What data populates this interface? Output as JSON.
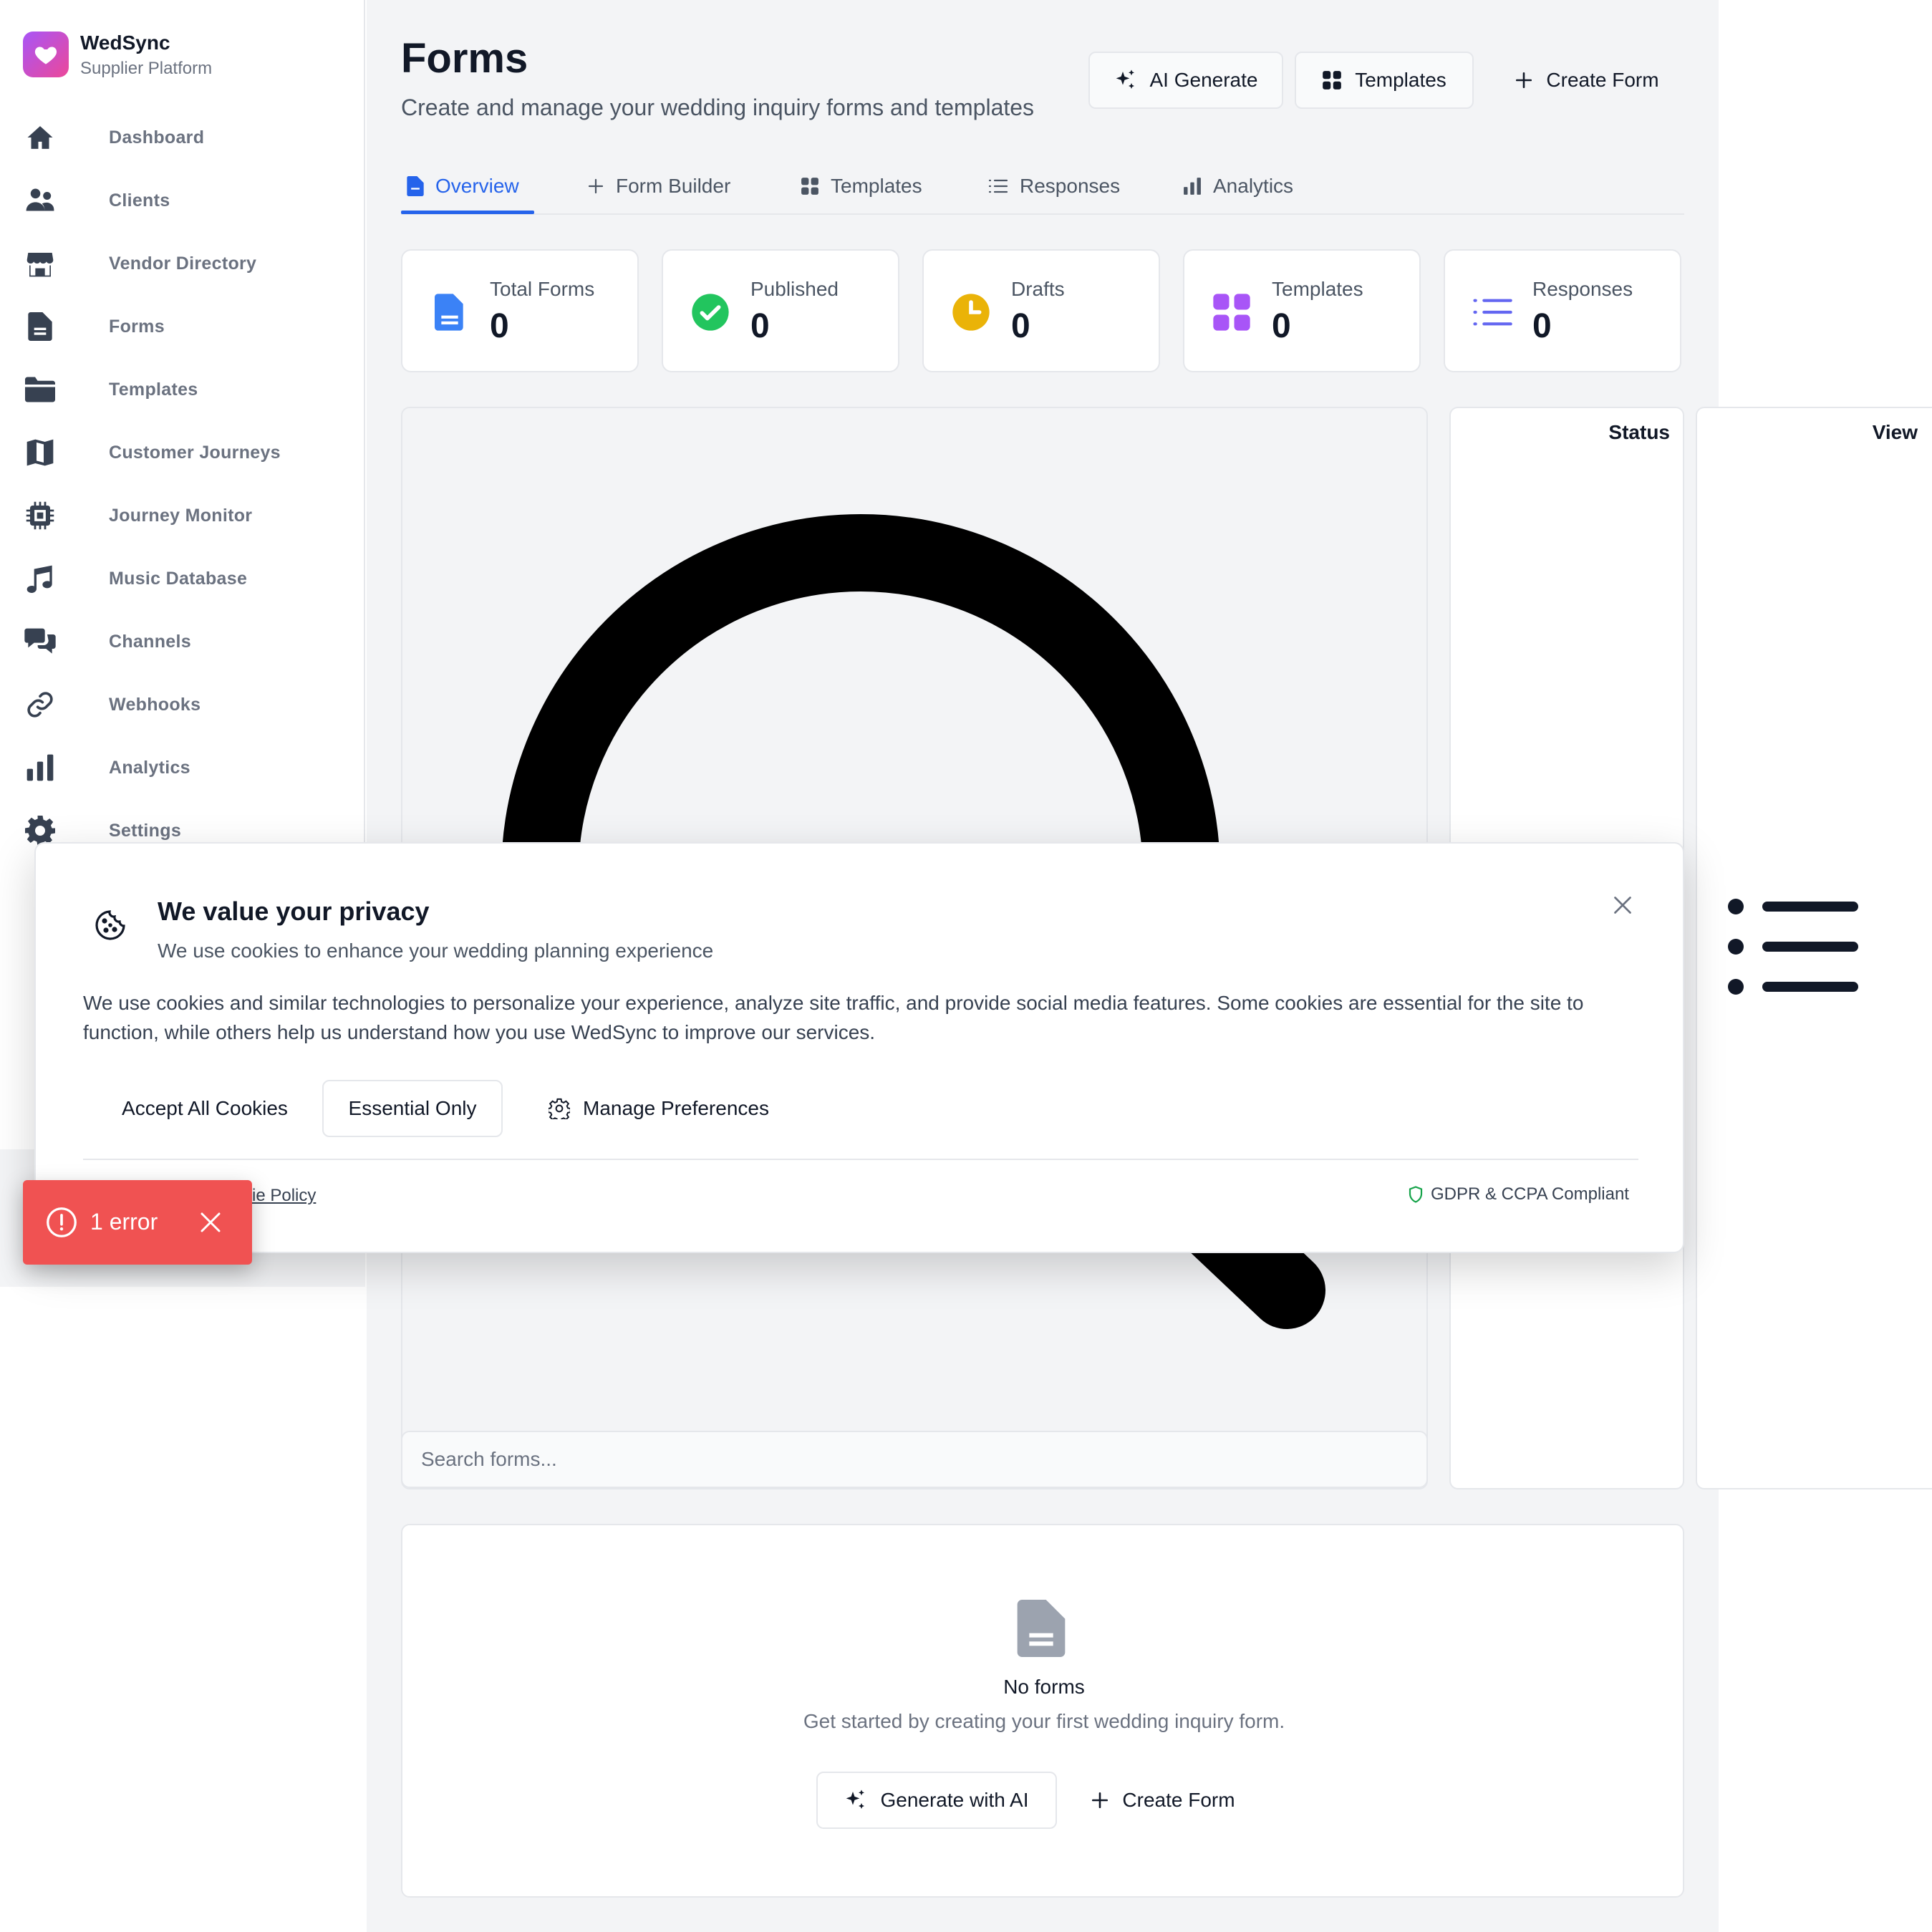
{
  "brand": {
    "name": "WedSync",
    "subtitle": "Supplier Platform",
    "accent": "#ec4899"
  },
  "sidebar": {
    "items": [
      {
        "label": "Dashboard",
        "icon": "home-icon"
      },
      {
        "label": "Clients",
        "icon": "users-icon"
      },
      {
        "label": "Vendor Directory",
        "icon": "storefront-icon"
      },
      {
        "label": "Forms",
        "icon": "document-icon"
      },
      {
        "label": "Templates",
        "icon": "folder-icon"
      },
      {
        "label": "Customer Journeys",
        "icon": "map-icon"
      },
      {
        "label": "Journey Monitor",
        "icon": "cpu-chip-icon"
      },
      {
        "label": "Music Database",
        "icon": "music-note-icon"
      },
      {
        "label": "Channels",
        "icon": "chat-bubbles-icon"
      },
      {
        "label": "Webhooks",
        "icon": "link-icon"
      },
      {
        "label": "Analytics",
        "icon": "bar-chart-icon"
      },
      {
        "label": "Settings",
        "icon": "gear-icon"
      }
    ]
  },
  "header": {
    "title": "Forms",
    "subtitle": "Create and manage your wedding inquiry forms and templates",
    "actions": {
      "ai_generate": "AI Generate",
      "templates": "Templates",
      "create_form": "Create Form"
    }
  },
  "tabs": [
    {
      "label": "Overview",
      "icon": "document-icon",
      "active": true
    },
    {
      "label": "Form Builder",
      "icon": "plus-icon",
      "active": false
    },
    {
      "label": "Templates",
      "icon": "grid-icon",
      "active": false
    },
    {
      "label": "Responses",
      "icon": "list-icon",
      "active": false
    },
    {
      "label": "Analytics",
      "icon": "bar-chart-icon",
      "active": false
    }
  ],
  "stats": [
    {
      "label": "Total Forms",
      "value": "0",
      "icon": "document-icon",
      "color": "#3b82f6"
    },
    {
      "label": "Published",
      "value": "0",
      "icon": "check-circle-icon",
      "color": "#22c55e"
    },
    {
      "label": "Drafts",
      "value": "0",
      "icon": "clock-icon",
      "color": "#eab308"
    },
    {
      "label": "Templates",
      "value": "0",
      "icon": "grid-icon",
      "color": "#a855f7"
    },
    {
      "label": "Responses",
      "value": "0",
      "icon": "list-icon",
      "color": "#6366f1"
    }
  ],
  "filters": {
    "search_placeholder": "Search forms...",
    "status_label": "Status",
    "view_label": "View"
  },
  "empty_state": {
    "title": "No forms",
    "description": "Get started by creating your first wedding inquiry form.",
    "generate_label": "Generate with AI",
    "create_label": "Create Form"
  },
  "cookie_banner": {
    "title": "We value your privacy",
    "subtitle": "We use cookies to enhance your wedding planning experience",
    "body": "We use cookies and similar technologies to personalize your experience, analyze site traffic, and provide social media features. Some cookies are essential for the site to function, while others help us understand how you use WedSync to improve our services.",
    "accept_all": "Accept All Cookies",
    "essential_only": "Essential Only",
    "manage": "Manage Preferences",
    "policy_link": "kie Policy",
    "compliance": "GDPR & CCPA Compliant"
  },
  "error_toast": {
    "text": "1 error",
    "color": "#f05252"
  }
}
